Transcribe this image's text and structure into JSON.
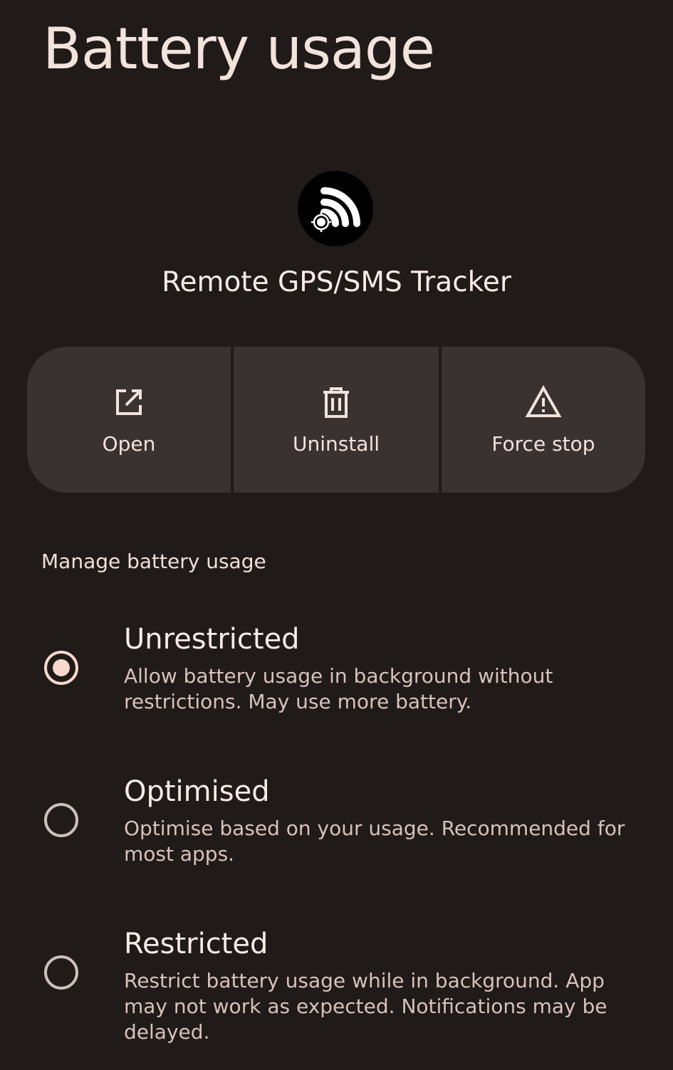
{
  "page": {
    "title": "Battery usage"
  },
  "app": {
    "name": "Remote GPS/SMS Tracker",
    "icon": "gps-tracker-app-icon"
  },
  "actions": [
    {
      "label": "Open",
      "icon": "open-external-icon"
    },
    {
      "label": "Uninstall",
      "icon": "trash-icon"
    },
    {
      "label": "Force stop",
      "icon": "warning-icon"
    }
  ],
  "manage": {
    "section_title": "Manage battery usage",
    "options": [
      {
        "title": "Unrestricted",
        "description": "Allow battery usage in background without restrictions. May use more battery.",
        "selected": true
      },
      {
        "title": "Optimised",
        "description": "Optimise based on your usage. Recommended for most apps.",
        "selected": false
      },
      {
        "title": "Restricted",
        "description": "Restrict battery usage while in background. App may not work as expected. Notifications may be delayed.",
        "selected": false
      }
    ]
  },
  "colors": {
    "background": "#201a18",
    "surface": "#3a3230",
    "accent": "#f6d8cd"
  }
}
